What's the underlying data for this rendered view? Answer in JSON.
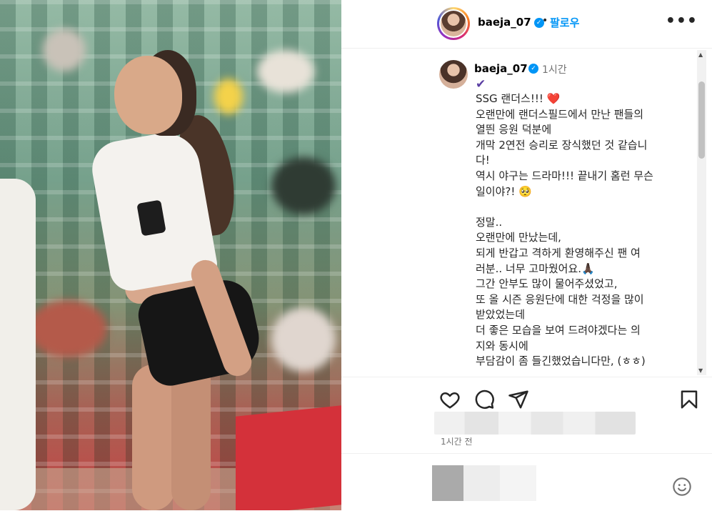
{
  "header": {
    "username": "baeja_07",
    "verified": true,
    "follow_label": "팔로우",
    "separator": "•",
    "more_label": "•••"
  },
  "caption": {
    "username": "baeja_07",
    "time": "1시간",
    "check_mark": "✔",
    "text": "SSG 랜더스!!! ❤️\n오랜만에 랜더스필드에서 만난 팬들의\n열띈 응원 덕분에\n개막 2연전 승리로 장식했던 것 같습니\n다!\n역시 야구는 드라마!!! 끝내기 홈런 무슨\n일이야?! 🥺\n\n정말..\n오랜만에 만났는데,\n되게 반갑고 격하게 환영해주신 팬 여\n러분.. 너무 고마웠어요.🙏🏿\n그간 안부도 많이 물어주셨었고,\n또 올 시즌 응원단에 대한 걱정을 많이\n받았었는데\n더 좋은 모습을 보여 드려야겠다는 의\n지와 동시에\n부담감이 좀 들긴했었습니다만, (ㅎㅎ)"
  },
  "actions": {
    "icons": [
      "heart-icon",
      "comment-icon",
      "share-icon",
      "bookmark-icon"
    ]
  },
  "post_time": "1시간 전",
  "colors": {
    "accent": "#0095f6",
    "text": "#262626",
    "muted": "#737373",
    "border": "#efefef"
  }
}
